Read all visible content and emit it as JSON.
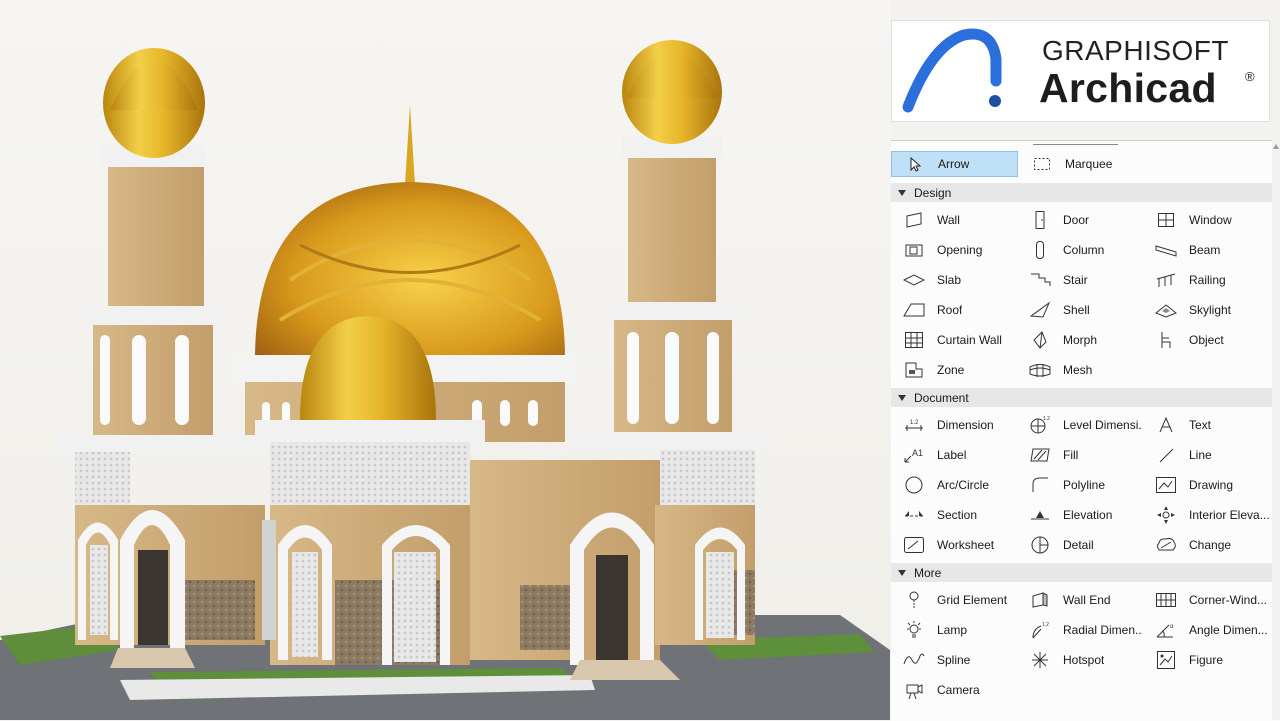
{
  "logo": {
    "brand": "GRAPHISOFT",
    "product": "Archicad",
    "reg": "®",
    "colors": {
      "swoosh": "#2a6fdb",
      "dot": "#1d4f9e"
    }
  },
  "toolbox": {
    "top": {
      "arrow": "Arrow",
      "marquee": "Marquee"
    },
    "sections": {
      "design": "Design",
      "document": "Document",
      "more": "More"
    },
    "design": {
      "wall": "Wall",
      "door": "Door",
      "window": "Window",
      "opening": "Opening",
      "column": "Column",
      "beam": "Beam",
      "slab": "Slab",
      "stair": "Stair",
      "railing": "Railing",
      "roof": "Roof",
      "shell": "Shell",
      "skylight": "Skylight",
      "curtain_wall": "Curtain Wall",
      "morph": "Morph",
      "object": "Object",
      "zone": "Zone",
      "mesh": "Mesh"
    },
    "document": {
      "dimension": "Dimension",
      "level_dimension": "Level Dimensi...",
      "text": "Text",
      "label": "Label",
      "fill": "Fill",
      "line": "Line",
      "arc_circle": "Arc/Circle",
      "polyline": "Polyline",
      "drawing": "Drawing",
      "section": "Section",
      "elevation": "Elevation",
      "interior_elevation": "Interior Eleva...",
      "worksheet": "Worksheet",
      "detail": "Detail",
      "change": "Change"
    },
    "more": {
      "grid_element": "Grid Element",
      "wall_end": "Wall End",
      "corner_window": "Corner-Wind...",
      "lamp": "Lamp",
      "radial_dimension": "Radial Dimen...",
      "angle_dimension": "Angle Dimen...",
      "spline": "Spline",
      "hotspot": "Hotspot",
      "figure": "Figure",
      "camera": "Camera"
    },
    "colors": {
      "selected_bg": "#bfe0f6",
      "section_bg": "#e7e7e7"
    }
  }
}
